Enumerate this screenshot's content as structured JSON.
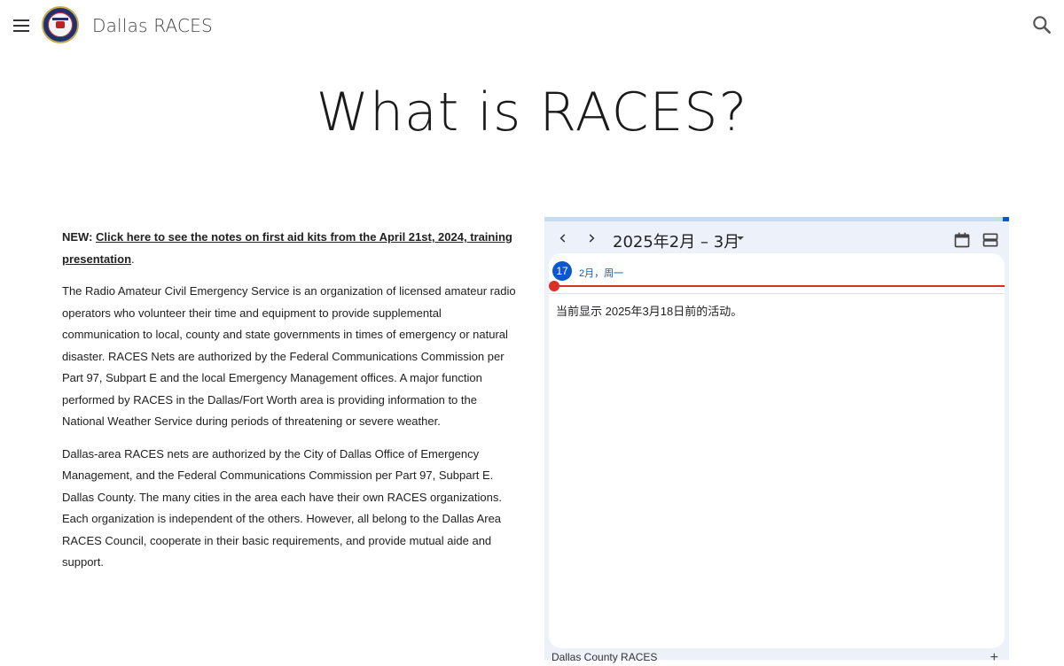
{
  "header": {
    "site_title": "Dallas RACES",
    "icons": {
      "menu": "menu-icon",
      "search": "search-icon"
    }
  },
  "page": {
    "title": "What is RACES?"
  },
  "content": {
    "new_prefix": "NEW: ",
    "new_link": "Click here to see the notes on first aid kits from the April 21st, 2024, training presentation",
    "new_suffix": ".",
    "paragraph1": "The Radio Amateur Civil Emergency Service is an organization of licensed amateur radio operators who volunteer their time and equipment to provide supplemental communication to local, county and state governments in times of emergency or natural disaster. RACES Nets are authorized by the Federal Communications Commission per Part 97, Subpart E and the local Emergency Management offices. A major function performed by RACES in the Dallas/Fort Worth area is providing information to the National Weather Service during periods of threatening or severe weather.",
    "paragraph2": "Dallas-area RACES nets are authorized by the City of Dallas Office of Emergency Management, and the Federal Communications Commission per Part 97, Subpart E. Dallas County. The many cities in the area each have their own RACES organizations. Each organization is independent of the others. However, all belong to the Dallas Area RACES Council, cooperate in their basic requirements, and provide mutual aide and support."
  },
  "calendar": {
    "range_label": "2025年2月 – 3月",
    "day_number": "17",
    "day_label": "2月，周一",
    "message": "当前显示 2025年3月18日前的活动。",
    "footer_label": "Dallas County RACES",
    "plus_label": "+",
    "colors": {
      "accent": "#0b57d0",
      "now": "#d93025",
      "panel_bg": "#edf2fa"
    },
    "icons": {
      "prev": "chevron-left-icon",
      "next": "chevron-right-icon",
      "dropdown": "caret-down-icon",
      "month_view": "calendar-icon",
      "agenda_view": "agenda-icon"
    }
  }
}
